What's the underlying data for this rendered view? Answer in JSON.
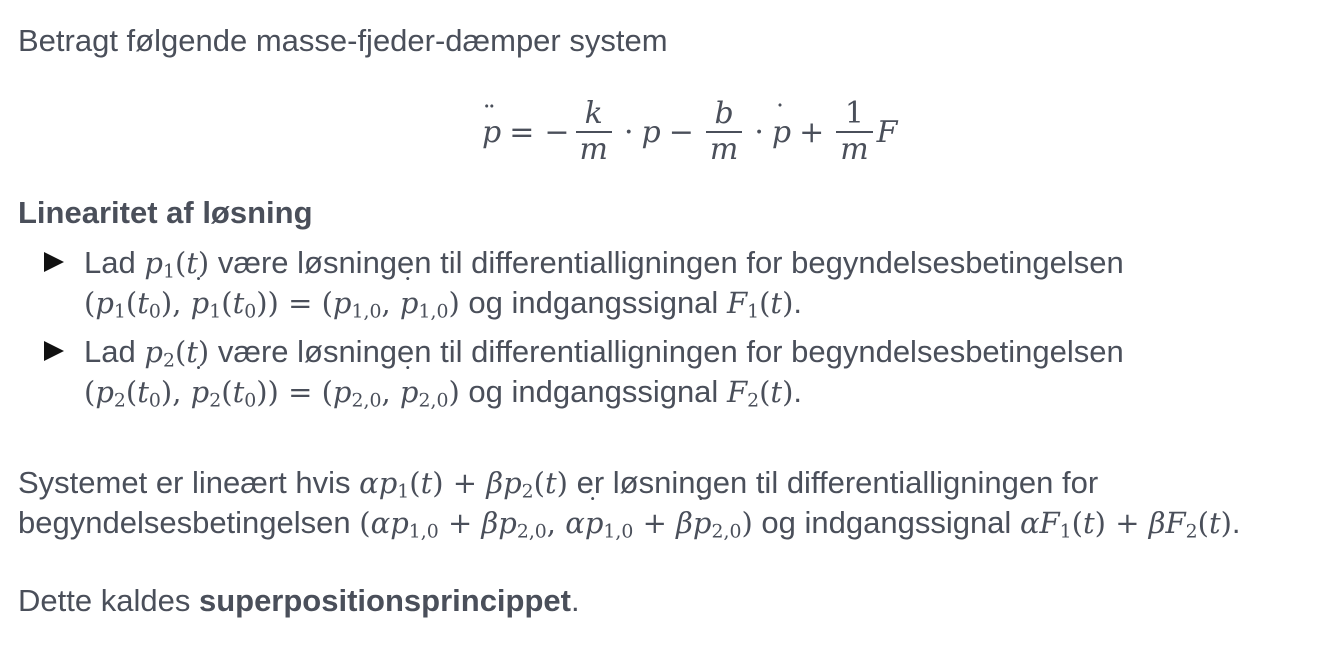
{
  "intro": "Betragt følgende masse-fjeder-dæmper system",
  "heading": "Linearitet af løsning",
  "bullet_lad": "Lad",
  "bullet_text": "være løsningen til differentialligningen for begyndelsesbetingelsen",
  "og_indgang": "og indgangssignal",
  "systemet_a": "Systemet er lineært hvis",
  "systemet_b": "er løsningen til differentialligningen for",
  "begyndelse": "begyndelsesbetingelsen",
  "dette": "Dette kaldes",
  "bold_term": "superpositionsprincippet",
  "period": "."
}
